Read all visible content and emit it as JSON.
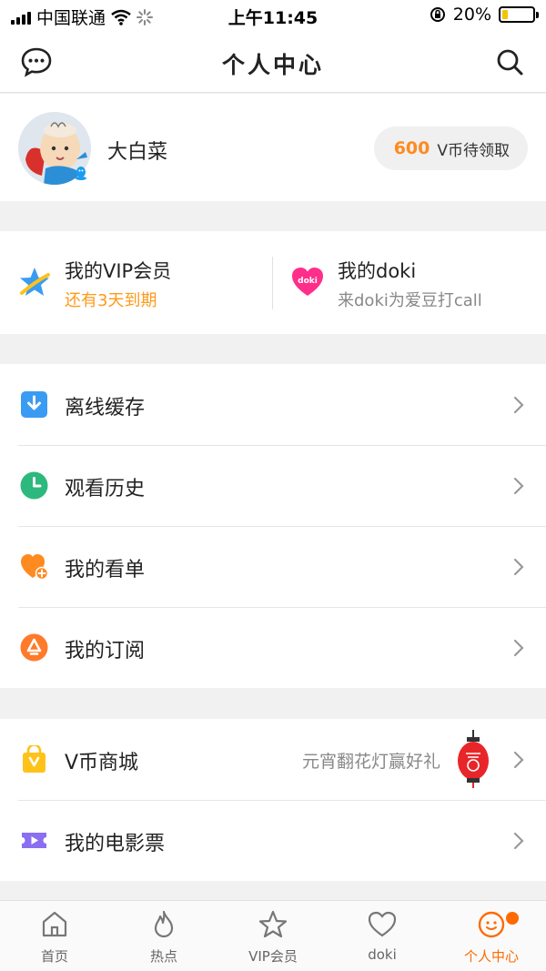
{
  "status_bar": {
    "carrier": "中国联通",
    "time": "上午11:45",
    "battery_percent": "20%",
    "battery_level": 0.2
  },
  "nav": {
    "title": "个人中心",
    "left_icon": "message-icon",
    "right_icon": "search-icon"
  },
  "profile": {
    "username": "大白菜",
    "coins_amount": "600",
    "coins_text": "V币待领取"
  },
  "vip": {
    "membership": {
      "title": "我的VIP会员",
      "subtitle": "还有3天到期"
    },
    "doki": {
      "title": "我的doki",
      "subtitle": "来doki为爱豆打call",
      "logo_text": "doki"
    }
  },
  "menu_group_1": [
    {
      "label": "离线缓存",
      "icon": "download-icon"
    },
    {
      "label": "观看历史",
      "icon": "clock-icon"
    },
    {
      "label": "我的看单",
      "icon": "heart-plus-icon"
    },
    {
      "label": "我的订阅",
      "icon": "subscribe-icon"
    }
  ],
  "menu_group_2": [
    {
      "label": "V币商城",
      "icon": "shopping-bag-icon",
      "extra": "元宵翻花灯赢好礼"
    },
    {
      "label": "我的电影票",
      "icon": "ticket-icon"
    }
  ],
  "tabbar": [
    {
      "label": "首页",
      "icon": "home-icon"
    },
    {
      "label": "热点",
      "icon": "flame-icon"
    },
    {
      "label": "VIP会员",
      "icon": "vip-star-icon"
    },
    {
      "label": "doki",
      "icon": "doki-heart-icon"
    },
    {
      "label": "个人中心",
      "icon": "profile-icon",
      "active": true
    }
  ],
  "colors": {
    "accent_orange": "#ff8a1f",
    "active_tab": "#ff6a00",
    "expiry_text": "#ff9a1a",
    "doki_pink": "#ff2e8a"
  }
}
